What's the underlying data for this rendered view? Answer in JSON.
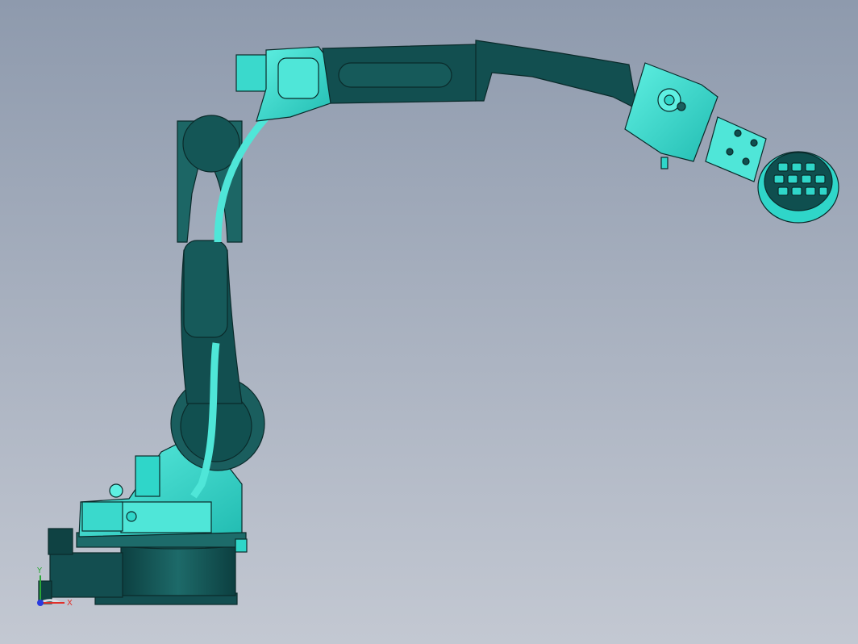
{
  "viewport": {
    "background_top": "#8e9aad",
    "background_bottom": "#c3c8d2"
  },
  "model": {
    "primary_color": "#2fd6c9",
    "dark_color": "#0f4f4f",
    "edge_color": "#0a2a2a"
  },
  "triad": {
    "x_label": "X",
    "y_label": "Y",
    "x_color": "#e0302a",
    "y_color": "#2aa836",
    "z_color": "#2a3ae0"
  }
}
